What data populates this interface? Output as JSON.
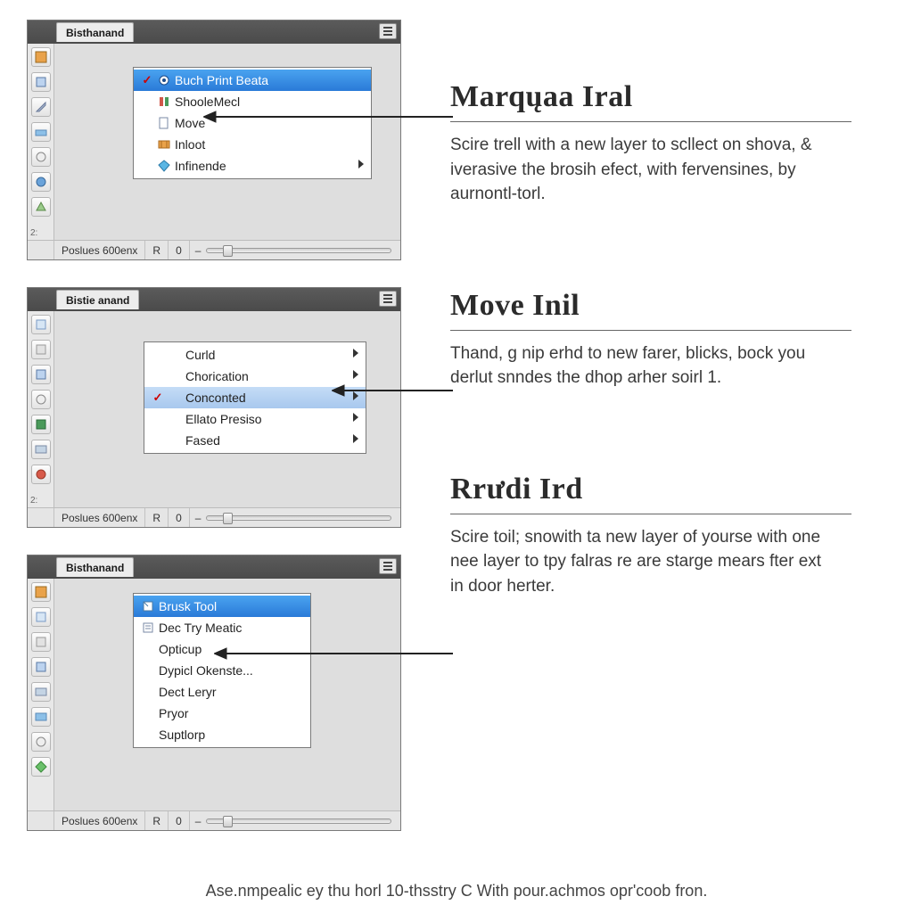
{
  "panels": [
    {
      "tab": "Bisthanand",
      "status": {
        "left": "Poslues 600enx",
        "mid": "R",
        "val": "0"
      },
      "menu": {
        "items": [
          {
            "label": "Buch Print Beata",
            "checked": true,
            "selected": true,
            "icon": "target",
            "arrow": false
          },
          {
            "label": "ShooleMecl",
            "icon": "shape",
            "arrow": false
          },
          {
            "label": "Move",
            "icon": "page",
            "arrow": false
          },
          {
            "label": "Inloot",
            "icon": "film",
            "arrow": false
          },
          {
            "label": "Infinende",
            "icon": "diamond",
            "arrow": true
          }
        ]
      }
    },
    {
      "tab": "Bistie anand",
      "status": {
        "left": "Poslues 600enx",
        "mid": "R",
        "val": "0"
      },
      "menu": {
        "items": [
          {
            "label": "Curld",
            "arrow": true
          },
          {
            "label": "Chorication",
            "arrow": true
          },
          {
            "label": "Conconted",
            "checked": true,
            "selgray": true,
            "arrow": true
          },
          {
            "label": "Ellato Presiso",
            "arrow": true
          },
          {
            "label": "Fased",
            "arrow": true
          }
        ]
      }
    },
    {
      "tab": "Bisthanand",
      "status": {
        "left": "Poslues 600enx",
        "mid": "R",
        "val": "0"
      },
      "menu": {
        "items": [
          {
            "label": "Brusk Tool",
            "selected": true,
            "icon": "page"
          },
          {
            "label": "Dec Try Meatic",
            "icon": "list"
          },
          {
            "label": "Opticup"
          },
          {
            "label": "Dypicl Okenste..."
          },
          {
            "label": "Dect Leryr"
          },
          {
            "label": "Pryor"
          },
          {
            "label": "Suptlorp"
          }
        ]
      }
    }
  ],
  "info": [
    {
      "title": "Marqųaa Iral",
      "body": "Scire trell with a new layer to scllect on shova, & iverasive the brosih efect, with fervensines, by aurnontl-torl."
    },
    {
      "title": "Move Inil",
      "body": "Thand, g nip erhd to new farer, blicks, bock you derlut snndes the dhop arher soirl 1."
    },
    {
      "title": "Rrưdi Ird",
      "body": "Scire toil; snowith ta new layer of yourse with one nee layer to tpy falras re are starge mears fter ext in door herter."
    }
  ],
  "footnote": "Ase.nmpealic ey thu horl 10-thsstry C With pour.achmos opr'coob fron.",
  "corner": "2:"
}
